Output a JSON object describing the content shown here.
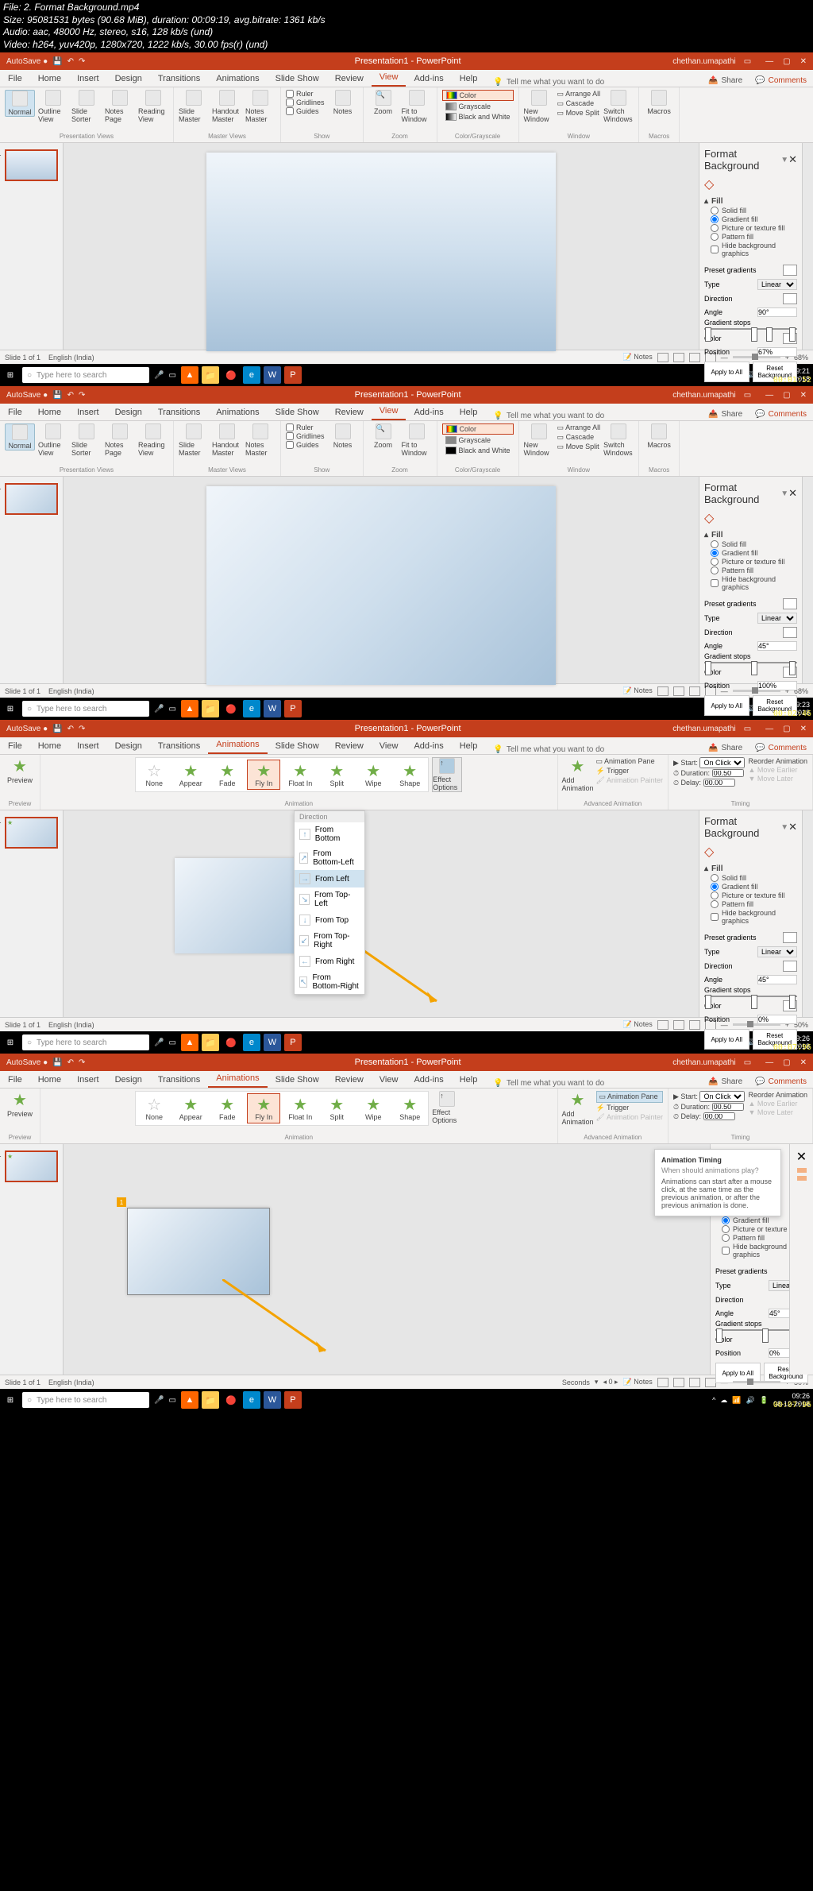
{
  "file_info": {
    "line1": "File: 2. Format Background.mp4",
    "line2": "Size: 95081531 bytes (90.68 MiB), duration: 00:09:19, avg.bitrate: 1361 kb/s",
    "line3": "Audio: aac, 48000 Hz, stereo, s16, 128 kb/s (und)",
    "line4": "Video: h264, yuv420p, 1280x720, 1222 kb/s, 30.00 fps(r) (und)"
  },
  "app_title": "Presentation1 - PowerPoint",
  "username": "chethan.umapathi",
  "tabs": [
    "File",
    "Home",
    "Insert",
    "Design",
    "Transitions",
    "Animations",
    "Slide Show",
    "Review",
    "View",
    "Add-ins",
    "Help"
  ],
  "tell_me": "Tell me what you want to do",
  "share": "Share",
  "comments": "Comments",
  "ribbon_view": {
    "pres_views": {
      "label": "Presentation Views",
      "items": [
        "Normal",
        "Outline View",
        "Slide Sorter",
        "Notes Page",
        "Reading View"
      ]
    },
    "master": {
      "label": "Master Views",
      "items": [
        "Slide Master",
        "Handout Master",
        "Notes Master"
      ]
    },
    "show": {
      "label": "Show",
      "items": [
        "Ruler",
        "Gridlines",
        "Guides"
      ],
      "notes": "Notes"
    },
    "zoom": {
      "label": "Zoom",
      "items": [
        "Zoom",
        "Fit to Window"
      ]
    },
    "color": {
      "label": "Color/Grayscale",
      "items": [
        "Color",
        "Grayscale",
        "Black and White"
      ]
    },
    "window": {
      "label": "Window",
      "new": "New Window",
      "arr": "Arrange All",
      "casc": "Cascade",
      "split": "Move Split",
      "switch": "Switch Windows"
    },
    "macros": {
      "label": "Macros",
      "btn": "Macros"
    }
  },
  "ribbon_anim": {
    "preview": {
      "label": "Preview",
      "btn": "Preview"
    },
    "gallery": {
      "label": "Animation",
      "items": [
        "None",
        "Appear",
        "Fade",
        "Fly In",
        "Float In",
        "Split",
        "Wipe",
        "Shape"
      ]
    },
    "effect_options": "Effect Options",
    "adv": {
      "label": "Advanced Animation",
      "add": "Add Animation",
      "pane": "Animation Pane",
      "trigger": "Trigger",
      "painter": "Animation Painter"
    },
    "timing": {
      "label": "Timing",
      "start": "Start:",
      "on_click": "On Click",
      "duration": "Duration:",
      "dur_val": "00.50",
      "delay": "Delay:",
      "delay_val": "00.00",
      "reorder": "Reorder Animation",
      "earlier": "Move Earlier",
      "later": "Move Later"
    }
  },
  "format_bg": {
    "title": "Format Background",
    "fill": "Fill",
    "solid": "Solid fill",
    "gradient": "Gradient fill",
    "picture": "Picture or texture fill",
    "pattern": "Pattern fill",
    "hide": "Hide background graphics",
    "preset": "Preset gradients",
    "type": "Type",
    "type_val": "Linear",
    "direction": "Direction",
    "angle": "Angle",
    "stops": "Gradient stops",
    "color": "Color",
    "position": "Position",
    "apply": "Apply to All",
    "reset": "Reset Background"
  },
  "instances": [
    {
      "angle": "90°",
      "position": "67%",
      "zoom": "68%",
      "time": "09:21",
      "date": "08-12-2018",
      "ts": "00:01:52"
    },
    {
      "angle": "45°",
      "position": "100%",
      "zoom": "68%",
      "time": "09:23",
      "date": "08-12-2018",
      "ts": "00:02:46"
    },
    {
      "angle": "45°",
      "position": "0%",
      "zoom": "50%",
      "time": "09:26",
      "date": "08-12-2018",
      "ts": "00:07:96"
    },
    {
      "angle": "45°",
      "position": "0%",
      "zoom": "50%",
      "time": "09:26",
      "date": "08-12-2018",
      "ts": "00:07:96"
    }
  ],
  "effect_menu": {
    "header": "Direction",
    "items": [
      "From Bottom",
      "From Bottom-Left",
      "From Left",
      "From Top-Left",
      "From Top",
      "From Top-Right",
      "From Right",
      "From Bottom-Right"
    ]
  },
  "tooltip": {
    "title": "Animation Timing",
    "sub": "When should animations play?",
    "body": "Animations can start after a mouse click, at the same time as the previous animation, or after the previous animation is done."
  },
  "statusbar": {
    "slide": "Slide 1 of 1",
    "lang": "English (India)",
    "notes": "Notes"
  },
  "search_placeholder": "Type here to search",
  "seconds": "Seconds"
}
